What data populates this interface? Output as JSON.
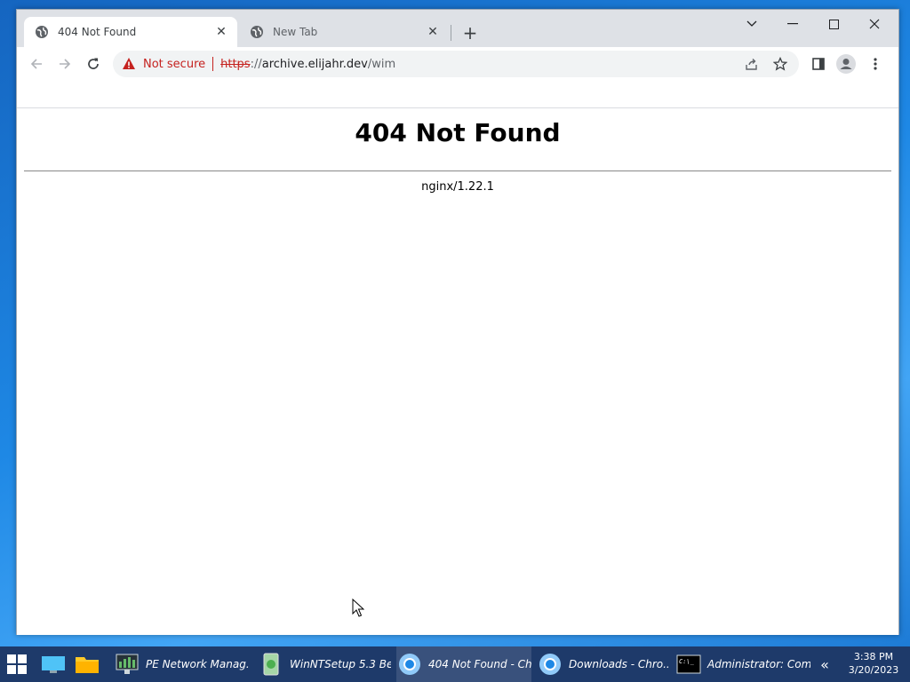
{
  "browser": {
    "tabs": [
      {
        "title": "404 Not Found",
        "active": true
      },
      {
        "title": "New Tab",
        "active": false
      }
    ],
    "address": {
      "security_label": "Not secure",
      "scheme": "https",
      "separator": "://",
      "host": "archive.elijahr.dev",
      "path": "/wim"
    }
  },
  "page": {
    "heading": "404 Not Found",
    "server": "nginx/1.22.1"
  },
  "taskbar": {
    "items": [
      {
        "label": "PE Network Manag...",
        "icon": "network-manager-icon"
      },
      {
        "label": "WinNTSetup 5.3 Be...",
        "icon": "winntsetup-icon"
      },
      {
        "label": "404 Not Found - Ch...",
        "icon": "chrome-icon",
        "active": true
      },
      {
        "label": "Downloads - Chro...",
        "icon": "chrome-icon"
      },
      {
        "label": "Administrator: Com...",
        "icon": "cmd-icon"
      }
    ],
    "time": "3:38 PM",
    "date": "3/20/2023"
  },
  "colors": {
    "warning": "#c5221f",
    "tab_strip": "#dee1e6",
    "taskbar": "#1e3a6a"
  }
}
